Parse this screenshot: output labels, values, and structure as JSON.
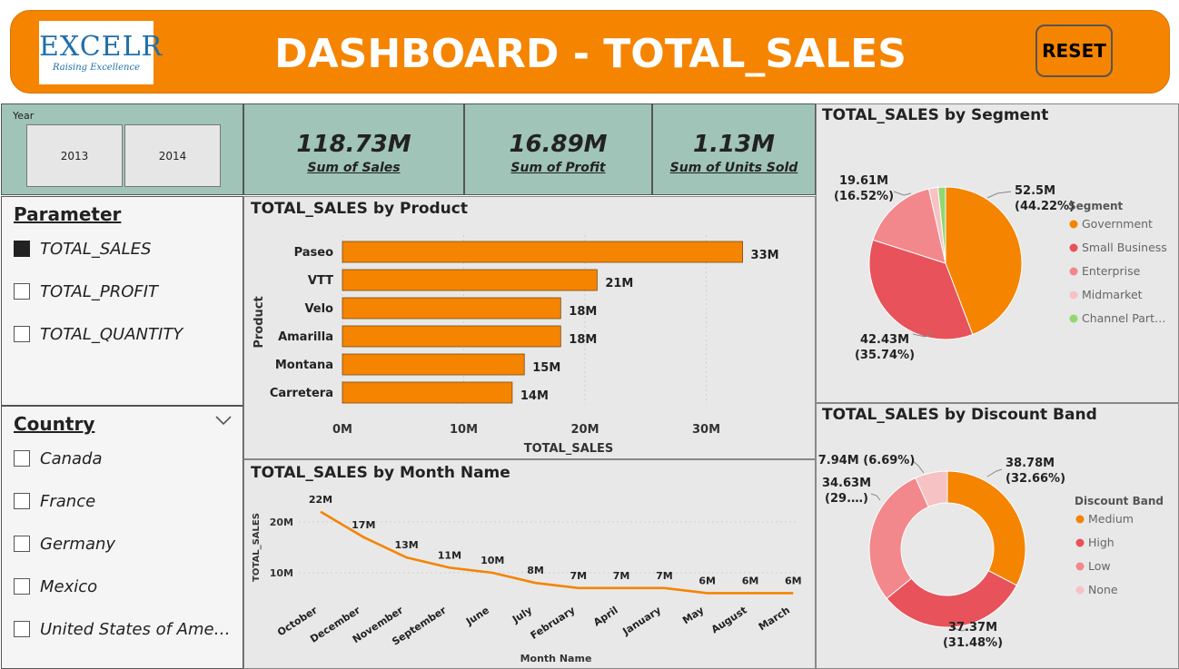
{
  "header": {
    "logo_main": "EXCELR",
    "logo_sub": "Raising Excellence",
    "title": "DASHBOARD - TOTAL_SALES",
    "reset_label": "RESET",
    "accent_color": "#f58400"
  },
  "year_slicer": {
    "label": "Year",
    "options": [
      "2013",
      "2014"
    ]
  },
  "kpis": [
    {
      "value": "118.73M",
      "label": "Sum of  Sales"
    },
    {
      "value": "16.89M",
      "label": "Sum of Profit"
    },
    {
      "value": "1.13M",
      "label": "Sum of Units Sold"
    }
  ],
  "parameter": {
    "title": "Parameter",
    "options": [
      {
        "label": "TOTAL_SALES",
        "checked": true
      },
      {
        "label": "TOTAL_PROFIT",
        "checked": false
      },
      {
        "label": "TOTAL_QUANTITY",
        "checked": false
      }
    ]
  },
  "country": {
    "title": "Country",
    "chevron_icon": "chevron-down-icon",
    "options": [
      "Canada",
      "France",
      "Germany",
      "Mexico",
      "United States of Ame…"
    ]
  },
  "chart_data": [
    {
      "type": "bar",
      "title": "TOTAL_SALES by Product",
      "orientation": "horizontal",
      "xlabel": "TOTAL_SALES",
      "ylabel": "Product",
      "categories": [
        "Paseo",
        "VTT",
        "Velo",
        "Amarilla",
        "Montana",
        "Carretera"
      ],
      "values": [
        33,
        21,
        18,
        18,
        15,
        14
      ],
      "data_labels": [
        "33M",
        "21M",
        "18M",
        "18M",
        "15M",
        "14M"
      ],
      "xticks": [
        "0M",
        "10M",
        "20M",
        "30M"
      ],
      "xlim": [
        0,
        35
      ],
      "color": "#f58400",
      "grid": true
    },
    {
      "type": "line",
      "title": "TOTAL_SALES by Month Name",
      "xlabel": "Month Name",
      "ylabel": "TOTAL_SALES",
      "categories": [
        "October",
        "December",
        "November",
        "September",
        "June",
        "July",
        "February",
        "April",
        "January",
        "May",
        "August",
        "March"
      ],
      "values": [
        22,
        17,
        13,
        11,
        10,
        8,
        7,
        7,
        7,
        6,
        6,
        6
      ],
      "data_labels": [
        "22M",
        "17M",
        "13M",
        "11M",
        "10M",
        "8M",
        "7M",
        "7M",
        "7M",
        "6M",
        "6M",
        "6M"
      ],
      "yticks": [
        "10M",
        "20M"
      ],
      "ylim": [
        5,
        23
      ],
      "color": "#f58400",
      "grid": true
    },
    {
      "type": "pie",
      "title": "TOTAL_SALES by Segment",
      "legend_title": "Segment",
      "legend_position": "right",
      "slices": [
        {
          "name": "Government",
          "value": 52.5,
          "label": "52.5M\n(44.22%)",
          "color": "#f58400"
        },
        {
          "name": "Small Business",
          "value": 42.43,
          "label": "42.43M\n(35.74%)",
          "color": "#e8525a"
        },
        {
          "name": "Enterprise",
          "value": 19.61,
          "label": "19.61M\n(16.52%)",
          "color": "#f2888c"
        },
        {
          "name": "Midmarket",
          "value": 2.3,
          "label": "",
          "color": "#f7c2c4"
        },
        {
          "name": "Channel Part…",
          "value": 1.89,
          "label": "",
          "color": "#8fd970"
        }
      ]
    },
    {
      "type": "pie",
      "subtype": "donut",
      "title": "TOTAL_SALES by Discount Band",
      "legend_title": "Discount Band",
      "legend_position": "right",
      "slices": [
        {
          "name": "Medium",
          "value": 38.78,
          "label": "38.78M\n(32.66%)",
          "color": "#f58400"
        },
        {
          "name": "High",
          "value": 37.37,
          "label": "37.37M\n(31.48%)",
          "color": "#e8525a"
        },
        {
          "name": "Low",
          "value": 34.63,
          "label": "34.63M\n(29.…)",
          "color": "#f2888c"
        },
        {
          "name": "None",
          "value": 7.94,
          "label": "7.94M (6.69%)",
          "color": "#f7c2c4"
        }
      ]
    }
  ]
}
